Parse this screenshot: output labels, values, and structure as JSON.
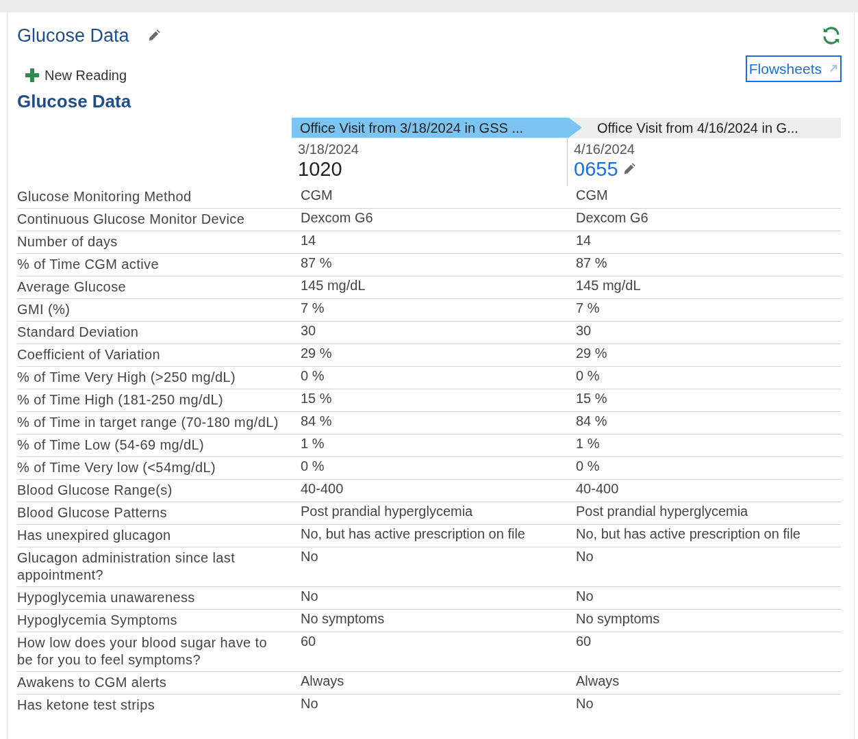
{
  "panel": {
    "title": "Glucose Data",
    "new_reading": "New Reading",
    "flowsheets_link": "Flowsheets"
  },
  "section_title": "Glucose Data",
  "visits": [
    {
      "label": "Office Visit from 3/18/2024 in GSS ...",
      "selected": true,
      "date": "3/18/2024",
      "time": "1020",
      "editable": false
    },
    {
      "label": "Office Visit from 4/16/2024 in G...",
      "selected": false,
      "date": "4/16/2024",
      "time": "0655",
      "editable": true
    }
  ],
  "rows": [
    {
      "label": "Glucose Monitoring Method",
      "values": [
        "CGM",
        "CGM"
      ]
    },
    {
      "label": "Continuous Glucose Monitor Device",
      "values": [
        "Dexcom G6",
        "Dexcom G6"
      ]
    },
    {
      "label": "Number of days",
      "values": [
        "14",
        "14"
      ]
    },
    {
      "label": "% of Time CGM active",
      "values": [
        "87 %",
        "87 %"
      ]
    },
    {
      "label": "Average Glucose",
      "values": [
        "145 mg/dL",
        "145 mg/dL"
      ]
    },
    {
      "label": "GMI (%)",
      "values": [
        "7 %",
        "7 %"
      ]
    },
    {
      "label": "Standard Deviation",
      "values": [
        "30",
        "30"
      ]
    },
    {
      "label": "Coefficient of Variation",
      "values": [
        "29 %",
        "29 %"
      ]
    },
    {
      "label": "% of Time Very High (>250 mg/dL)",
      "values": [
        "0 %",
        "0 %"
      ]
    },
    {
      "label": "% of Time High (181-250 mg/dL)",
      "values": [
        "15 %",
        "15 %"
      ]
    },
    {
      "label": "% of Time in target range (70-180 mg/dL)",
      "values": [
        "84 %",
        "84 %"
      ]
    },
    {
      "label": "% of Time Low (54-69 mg/dL)",
      "values": [
        "1 %",
        "1 %"
      ]
    },
    {
      "label": "% of Time Very low (<54mg/dL)",
      "values": [
        "0 %",
        "0 %"
      ]
    },
    {
      "label": "Blood Glucose Range(s)",
      "values": [
        "40-400",
        "40-400"
      ]
    },
    {
      "label": "Blood Glucose Patterns",
      "values": [
        "Post prandial hyperglycemia",
        "Post prandial hyperglycemia"
      ]
    },
    {
      "label": "Has unexpired glucagon",
      "values": [
        "No, but has active prescription on file",
        "No, but has active prescription on file"
      ]
    },
    {
      "label": "Glucagon administration since last appointment?",
      "values": [
        "No",
        "No"
      ]
    },
    {
      "label": "Hypoglycemia unawareness",
      "values": [
        "No",
        "No"
      ]
    },
    {
      "label": "Hypoglycemia Symptoms",
      "values": [
        "No symptoms",
        "No symptoms"
      ]
    },
    {
      "label": "How low does your blood sugar have to be for you to feel symptoms?",
      "values": [
        "60",
        "60"
      ]
    },
    {
      "label": "Awakens to CGM alerts",
      "values": [
        "Always",
        "Always"
      ]
    },
    {
      "label": "Has ketone test strips",
      "values": [
        "No",
        "No"
      ]
    }
  ]
}
